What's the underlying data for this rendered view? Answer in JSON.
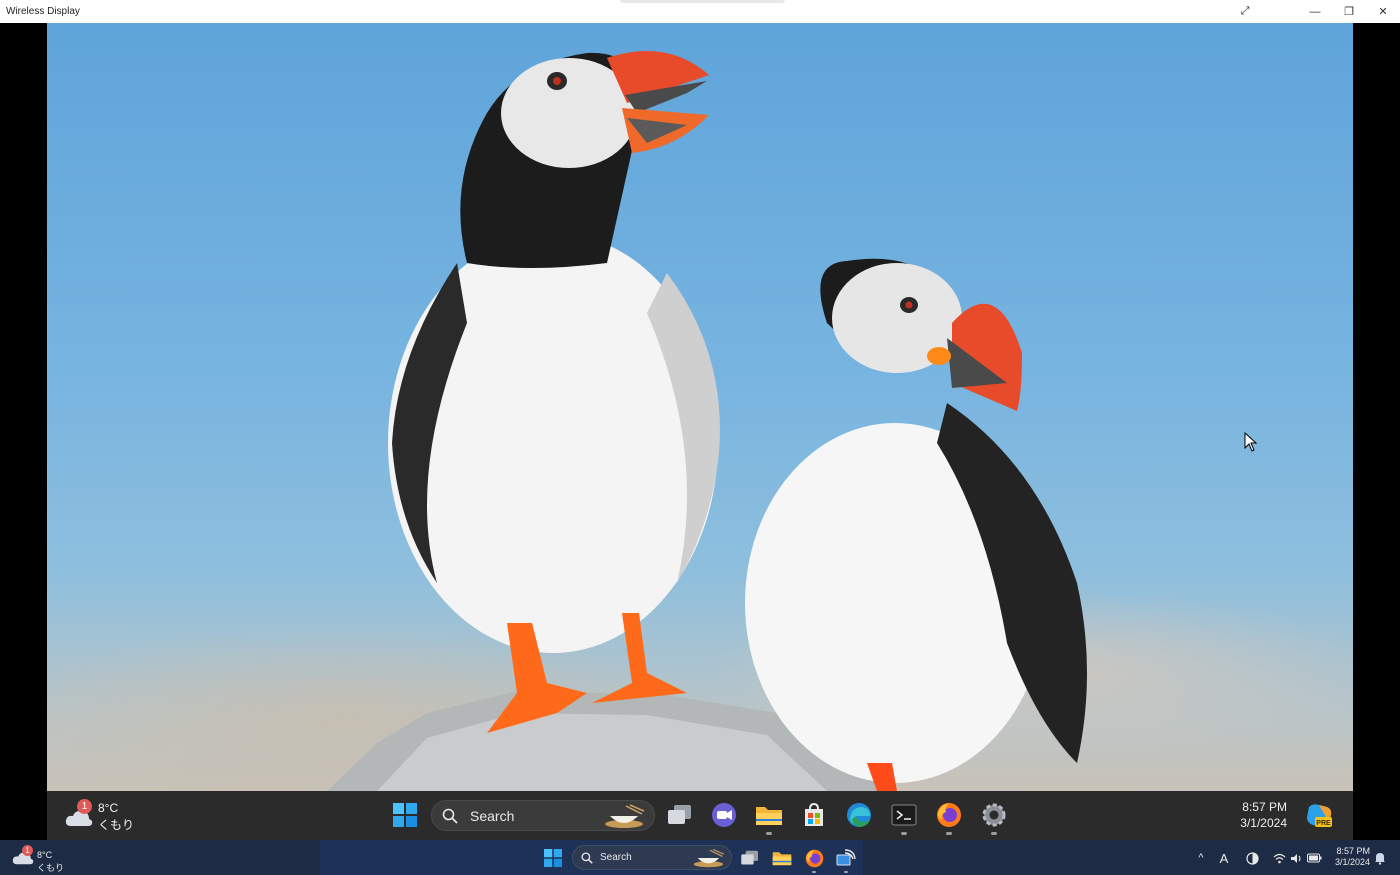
{
  "window": {
    "title": "Wireless Display",
    "controls": {
      "expand": "⤢",
      "minimize": "—",
      "maximize": "❐",
      "close": "✕"
    }
  },
  "remote": {
    "wallpaper_icon": "puffins-photo",
    "weather": {
      "temp": "8°C",
      "condition": "くもり",
      "badge": "1"
    },
    "search": {
      "label": "Search"
    },
    "apps": [
      "start-icon",
      "task-view-icon",
      "teams-icon",
      "file-explorer-icon",
      "store-icon",
      "edge-icon",
      "terminal-icon",
      "firefox-icon",
      "settings-icon"
    ],
    "clock": {
      "time": "8:57 PM",
      "date": "3/1/2024"
    },
    "copilot_badge": "PRE"
  },
  "taskbar": {
    "weather": {
      "temp": "8°C",
      "condition": "くもり",
      "badge": "1"
    },
    "search": {
      "label": "Search"
    },
    "apps": [
      "start-icon",
      "task-view-icon",
      "file-explorer-icon",
      "firefox-icon",
      "wireless-display-icon"
    ],
    "tray": {
      "chevron": "^",
      "ime": "A"
    },
    "clock": {
      "time": "8:57 PM",
      "date": "3/1/2024"
    }
  },
  "colors": {
    "sky": "#6aaede",
    "remote_taskbar": "#2b2b2b",
    "local_taskbar": "#1e2b44",
    "accent_blue": "#0a84ff"
  }
}
